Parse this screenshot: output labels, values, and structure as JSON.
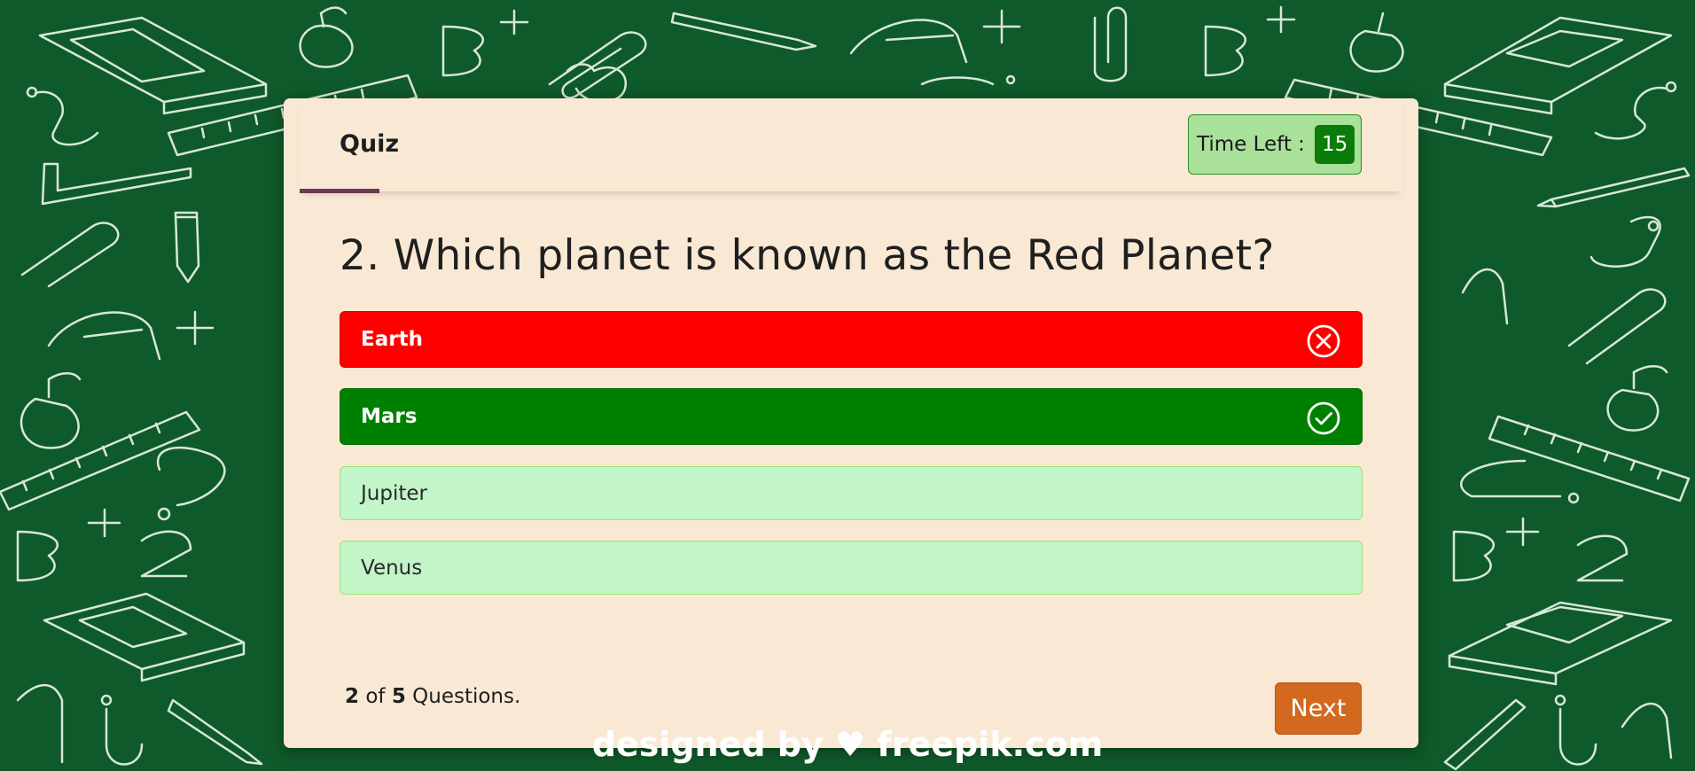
{
  "colors": {
    "background": "#0f5a2a",
    "card": "#f9e9d4",
    "wrong": "#ff0000",
    "correct": "#008000",
    "option_default": "#c2f5c8",
    "timer_bg": "#a9e09a",
    "timer_value_bg": "#0a7c0a",
    "next_button": "#d2691e",
    "title_underline": "#6b3a58"
  },
  "header": {
    "title": "Quiz",
    "timer_label": "Time Left :",
    "timer_value": "15"
  },
  "question": {
    "text": "2. Which planet is known as the Red Planet?"
  },
  "options": [
    {
      "label": "Earth",
      "state": "wrong",
      "icon": "cross-circle-icon"
    },
    {
      "label": "Mars",
      "state": "correct",
      "icon": "check-circle-icon"
    },
    {
      "label": "Jupiter",
      "state": "default"
    },
    {
      "label": "Venus",
      "state": "default"
    }
  ],
  "footer": {
    "current": "2",
    "of_text": "of",
    "total": "5",
    "suffix": "Questions.",
    "next_label": "Next"
  },
  "credit": {
    "text": "designed by ♥ freepik.com"
  }
}
